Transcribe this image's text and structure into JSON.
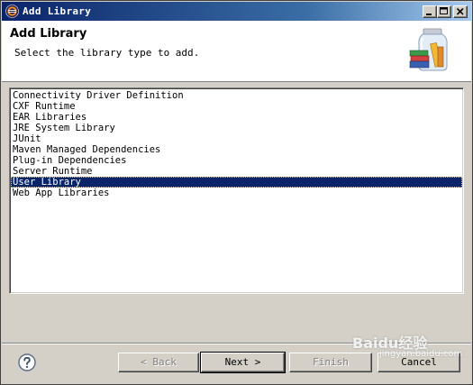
{
  "window": {
    "title": "Add Library"
  },
  "banner": {
    "heading": "Add Library",
    "description": "Select the library type to add."
  },
  "list": {
    "items": [
      "Connectivity Driver Definition",
      "CXF Runtime",
      "EAR Libraries",
      "JRE System Library",
      "JUnit",
      "Maven Managed Dependencies",
      "Plug-in Dependencies",
      "Server Runtime",
      "User Library",
      "Web App Libraries"
    ],
    "selected_index": 8
  },
  "buttons": {
    "back": "< Back",
    "next": "Next >",
    "finish": "Finish",
    "cancel": "Cancel"
  },
  "watermark": {
    "text": "Baidu经验",
    "sub": "jingyan.baidu.com"
  },
  "colors": {
    "title_bar": "#0a246a",
    "selection": "#0a246a",
    "dialog_bg": "#d4d0c8"
  },
  "icons": {
    "app": "eclipse-icon",
    "banner": "library-jar-icon",
    "help": "help-icon"
  }
}
